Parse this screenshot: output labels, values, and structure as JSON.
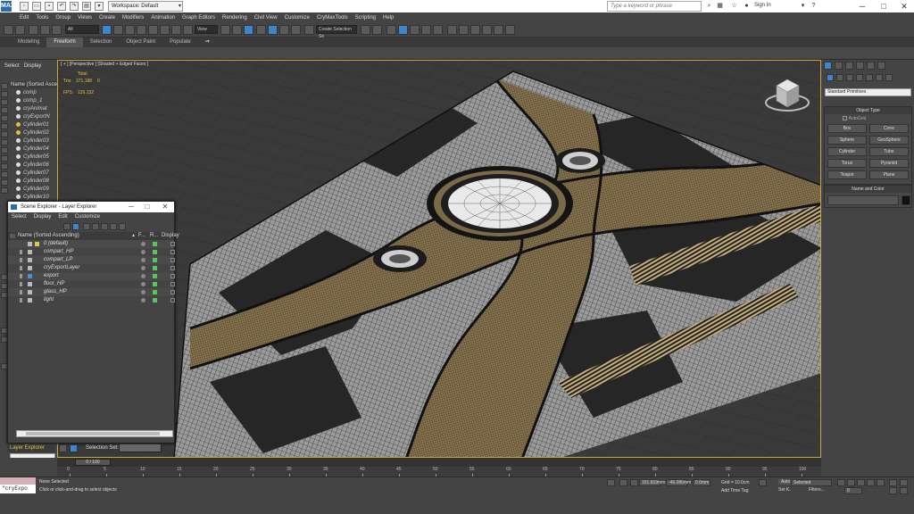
{
  "title_bar": {
    "logo": "MAX",
    "workspace_label": "Workspace: Default",
    "search_placeholder": "Type a keyword or phrase",
    "sign_in": "Sign In",
    "minimize": "─",
    "maximize": "□",
    "close": "✕"
  },
  "menu": [
    "Edit",
    "Tools",
    "Group",
    "Views",
    "Create",
    "Modifiers",
    "Animation",
    "Graph Editors",
    "Rendering",
    "Civil View",
    "Customize",
    "CryMaxTools",
    "Scripting",
    "Help"
  ],
  "toolbar": {
    "filter_value": "All",
    "refcoord_value": "View",
    "named_sel_value": "Create Selection Se"
  },
  "ribbon": {
    "tabs": [
      "Modeling",
      "Freeform",
      "Selection",
      "Object Paint",
      "Populate"
    ],
    "active_tab": "Freeform"
  },
  "scene_explorer": {
    "menu": [
      "Select",
      "Display"
    ],
    "header": "Name (Sorted Ascending)",
    "items": [
      {
        "name": "comp"
      },
      {
        "name": "comp_1"
      },
      {
        "name": "cryAnimat"
      },
      {
        "name": "cryExportN"
      },
      {
        "name": "Cylinder01"
      },
      {
        "name": "Cylinder02"
      },
      {
        "name": "Cylinder03"
      },
      {
        "name": "Cylinder04"
      },
      {
        "name": "Cylinder05"
      },
      {
        "name": "Cylinder06"
      },
      {
        "name": "Cylinder07"
      },
      {
        "name": "Cylinder08"
      },
      {
        "name": "Cylinder09"
      },
      {
        "name": "Cylinder10"
      }
    ]
  },
  "viewport": {
    "label": "[ + ] [Perspective ] [Shaded + Edged Faces ]",
    "stats": {
      "total_label": "Total",
      "tris_label": "Tris:",
      "tris_value": "371,188",
      "tris_extra": "0",
      "fps_label": "FPS:",
      "fps_value": "129.132"
    }
  },
  "layer_explorer": {
    "title": "Scene Explorer - Layer Explorer",
    "menu": [
      "Select",
      "Display",
      "Edit",
      "Customize"
    ],
    "columns": {
      "name": "Name (Sorted Ascending)",
      "freeze": "F...",
      "render": "R...",
      "display": "Display"
    },
    "layers": [
      {
        "name": "0 (default)"
      },
      {
        "name": "compart_HP"
      },
      {
        "name": "compart_LP"
      },
      {
        "name": "cryExportLayer"
      },
      {
        "name": "export"
      },
      {
        "name": "floor_HP"
      },
      {
        "name": "glass_HP"
      },
      {
        "name": "light"
      }
    ],
    "tab_label": "Layer Explorer",
    "selection_set_label": "Selection Set:"
  },
  "command_panel": {
    "dropdown": "Standard Primitives",
    "object_type_title": "Object Type",
    "autogrid": "AutoGrid",
    "buttons": [
      "Box",
      "Cone",
      "Sphere",
      "GeoSphere",
      "Cylinder",
      "Tube",
      "Torus",
      "Pyramid",
      "Teapot",
      "Plane"
    ],
    "name_color_title": "Name and Color"
  },
  "timeline": {
    "slider_label": "0 / 100",
    "ticks": [
      "0",
      "5",
      "10",
      "15",
      "20",
      "25",
      "30",
      "35",
      "40",
      "45",
      "50",
      "55",
      "60",
      "65",
      "70",
      "75",
      "80",
      "85",
      "90",
      "95",
      "100"
    ]
  },
  "status": {
    "maxscript": "\"cryExpo",
    "none_selected": "None Selected",
    "prompt": "Click or click-and-drag to select objects",
    "x_value": "151.819mm",
    "y_value": "-46.086mm",
    "z_value": "0.0mm",
    "grid": "Grid = 10.0cm",
    "add_time_tag": "Add Time Tag",
    "auto": "Auto",
    "set_k": "Set K.",
    "selected": "Selected",
    "filters": "Filters...",
    "frame": "0"
  }
}
